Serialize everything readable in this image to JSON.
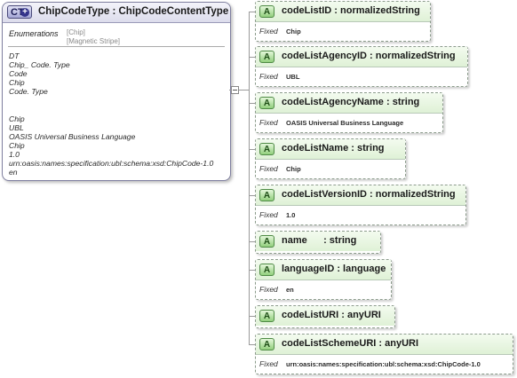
{
  "complex_type": {
    "badge": "CT",
    "badge_icon": "plus-icon",
    "title": "ChipCodeType : ChipCodeContentType",
    "enumerations_label": "Enumerations",
    "enumeration_values": [
      "[Chip]",
      "[Magnetic Stripe]"
    ],
    "annotations": [
      "DT",
      "Chip_ Code. Type",
      "Code",
      "Chip",
      "Code. Type",
      "",
      "",
      "Chip",
      "UBL",
      "OASIS Universal Business Language",
      "Chip",
      "1.0",
      "urn:oasis:names:specification:ubl:schema:xsd:ChipCode-1.0",
      "en"
    ]
  },
  "attribute_badge": "A",
  "fixed_label": "Fixed",
  "attributes": [
    {
      "name": "codeListID : normalizedString",
      "fixed": "Chip"
    },
    {
      "name": "codeListAgencyID : normalizedString",
      "fixed": "UBL"
    },
    {
      "name": "codeListAgencyName : string",
      "fixed": "OASIS Universal Business Language"
    },
    {
      "name": "codeListName : string",
      "fixed": "Chip"
    },
    {
      "name": "codeListVersionID : normalizedString",
      "fixed": "1.0"
    },
    {
      "name": "name      : string",
      "fixed": null
    },
    {
      "name": "languageID : language",
      "fixed": "en"
    },
    {
      "name": "codeListURI : anyURI",
      "fixed": null
    },
    {
      "name": "codeListSchemeURI : anyURI",
      "fixed": "urn:oasis:names:specification:ubl:schema:xsd:ChipCode-1.0"
    }
  ],
  "colors": {
    "attribute_header": "#dff1d6",
    "attribute_badge": "#92cf7d",
    "complex_type_badge": "#a6a8d6"
  }
}
